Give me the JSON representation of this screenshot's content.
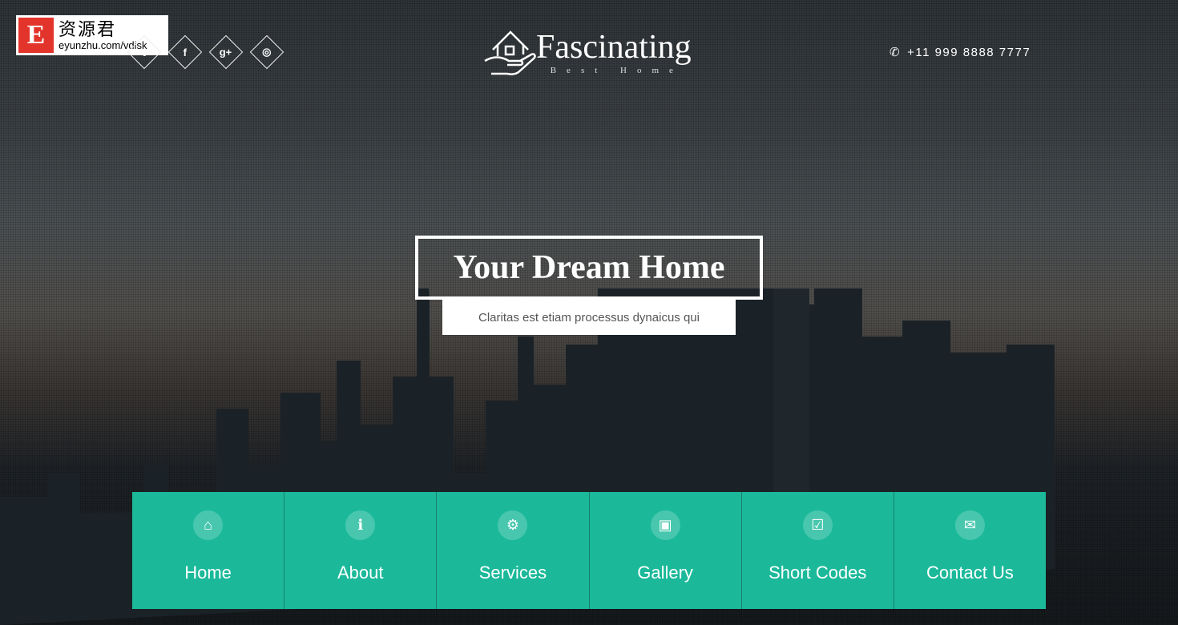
{
  "watermark": {
    "logo_letter": "E",
    "cn": "资源君",
    "url": "eyunzhu.com/vdisk"
  },
  "social": [
    {
      "icon": "twitter-icon",
      "glyph": "t"
    },
    {
      "icon": "facebook-icon",
      "glyph": "f"
    },
    {
      "icon": "google-plus-icon",
      "glyph": "g+"
    },
    {
      "icon": "dribbble-icon",
      "glyph": "◎"
    }
  ],
  "brand": {
    "title": "Fascinating",
    "subtitle": "Best Home"
  },
  "contact": {
    "phone": "+11 999 8888 7777"
  },
  "hero": {
    "title": "Your Dream Home",
    "subtitle": "Claritas est etiam processus dynaicus qui"
  },
  "nav": [
    {
      "label": "Home",
      "icon": "home-icon",
      "glyph": "⌂"
    },
    {
      "label": "About",
      "icon": "info-icon",
      "glyph": "ℹ"
    },
    {
      "label": "Services",
      "icon": "gear-icon",
      "glyph": "⚙"
    },
    {
      "label": "Gallery",
      "icon": "image-icon",
      "glyph": "▣"
    },
    {
      "label": "Short Codes",
      "icon": "check-square-icon",
      "glyph": "☑"
    },
    {
      "label": "Contact Us",
      "icon": "envelope-icon",
      "glyph": "✉"
    }
  ],
  "colors": {
    "accent": "#1bb99a"
  }
}
